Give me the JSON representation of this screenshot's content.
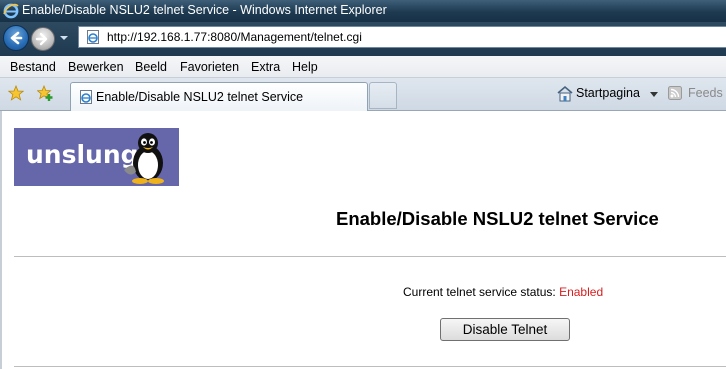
{
  "window": {
    "title": "Enable/Disable NSLU2 telnet Service - Windows Internet Explorer"
  },
  "address_bar": {
    "url": "http://192.168.1.77:8080/Management/telnet.cgi"
  },
  "menu": {
    "items": [
      "Bestand",
      "Bewerken",
      "Beeld",
      "Favorieten",
      "Extra",
      "Help"
    ]
  },
  "tabs": {
    "active_label": "Enable/Disable NSLU2 telnet Service"
  },
  "command_bar": {
    "home_label": "Startpagina",
    "feeds_label": "Feeds ("
  },
  "page": {
    "logo_text": "unslung",
    "heading": "Enable/Disable NSLU2 telnet Service",
    "status_label": "Current telnet service status:",
    "status_value": "Enabled",
    "status_color": "#d81e1e",
    "button_label": "Disable Telnet"
  }
}
